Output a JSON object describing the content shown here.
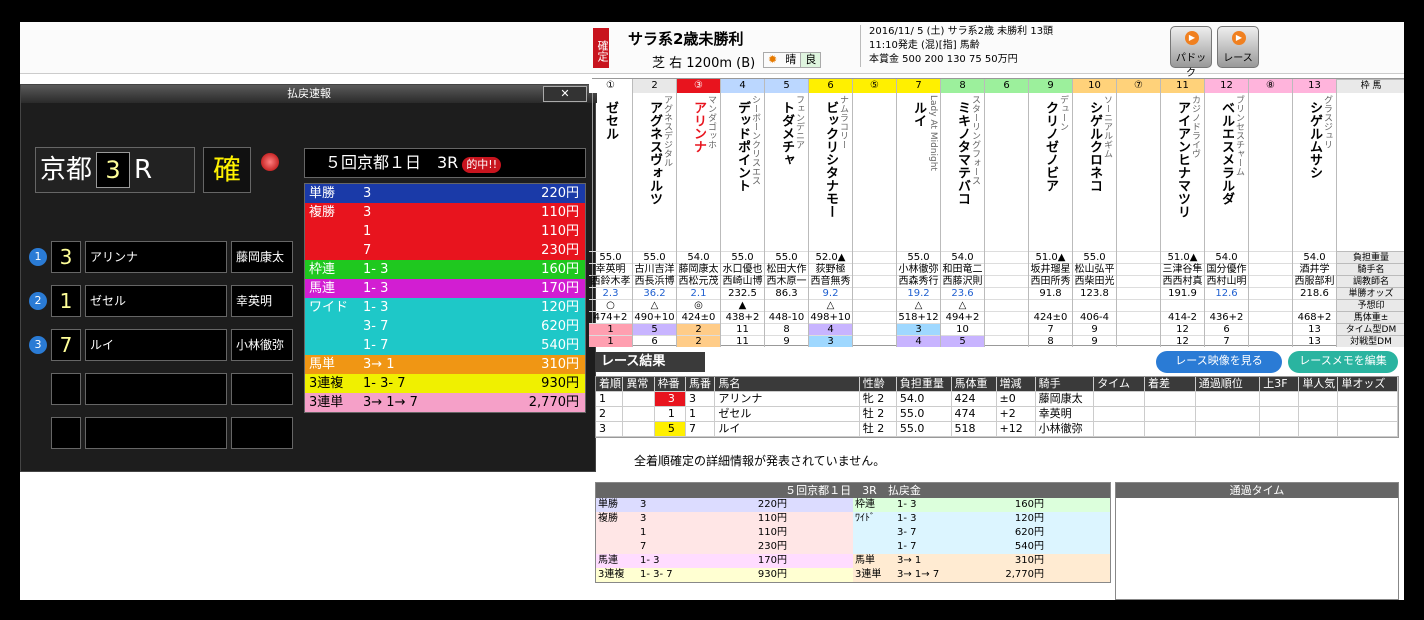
{
  "header": {
    "kakutei": "確定",
    "race_name": "サラ系2歳未勝利",
    "course": "芝 右 1200m (B)",
    "weather": "晴",
    "baba": "良",
    "info_line1": "2016/11/ 5 (土) サラ系2歳 未勝利 13頭",
    "info_line2": "11:10発走 (混)[指] 馬齢",
    "info_line3": "本賞金 500 200 130 75 50万円",
    "paddock_label": "パドック",
    "race_label": "レース"
  },
  "popup": {
    "title": "払戻速報",
    "close": "✕",
    "venue": "京都",
    "race_no": "3",
    "race_suffix": "R",
    "kaku": "確",
    "pay_header": "５回京都１日　3R",
    "hit": "的中!!",
    "ranks": [
      {
        "mark": "1",
        "horse_no": "3",
        "name": "アリンナ",
        "jockey": "藤岡康太"
      },
      {
        "mark": "2",
        "horse_no": "1",
        "name": "ゼセル",
        "jockey": "幸英明"
      },
      {
        "mark": "3",
        "horse_no": "7",
        "name": "ルイ",
        "jockey": "小林徹弥"
      }
    ],
    "payouts": [
      {
        "type": "単勝",
        "combo": "3",
        "value": "220円",
        "bg": "#1a3aa8"
      },
      {
        "type": "複勝",
        "combo": "3",
        "value": "110円",
        "bg": "#e8141e"
      },
      {
        "type": "",
        "combo": "1",
        "value": "110円",
        "bg": "#e8141e"
      },
      {
        "type": "",
        "combo": "7",
        "value": "230円",
        "bg": "#e8141e"
      },
      {
        "type": "枠連",
        "combo": "1- 3",
        "value": "160円",
        "bg": "#1fc81f"
      },
      {
        "type": "馬連",
        "combo": "1- 3",
        "value": "170円",
        "bg": "#d21ed2"
      },
      {
        "type": "ワイド",
        "combo": "1- 3",
        "value": "120円",
        "bg": "#1ec8c8"
      },
      {
        "type": "",
        "combo": "3- 7",
        "value": "620円",
        "bg": "#1ec8c8"
      },
      {
        "type": "",
        "combo": "1- 7",
        "value": "540円",
        "bg": "#1ec8c8"
      },
      {
        "type": "馬単",
        "combo": "3→ 1",
        "value": "310円",
        "bg": "#f09614"
      },
      {
        "type": "3連複",
        "combo": "1- 3- 7",
        "value": "930円",
        "bg": "#f0f000"
      },
      {
        "type": "3連単",
        "combo": "3→ 1→ 7",
        "value": "2,770円",
        "bg": "#f5a0c8"
      }
    ]
  },
  "entries": {
    "row_labels": [
      "枠 馬",
      "負担重量",
      "騎手名",
      "調教師名",
      "単勝オッズ",
      "予想印",
      "馬体重±",
      "タイム型DM",
      "対戦型DM"
    ],
    "horses": [
      {
        "waku": "13",
        "color": "#ffb4dc",
        "name": "シゲルムサシ",
        "sub": "グラスジュリ",
        "weight": "54.0",
        "jockey": "酒井学",
        "trainer": "西服部利",
        "odds": "218.6",
        "mark": "",
        "bw": "468+2",
        "dm1": "13",
        "dm2": "13"
      },
      {
        "waku": "⑧",
        "color": "#ffb4dc",
        "name": "",
        "sub": "",
        "weight": "",
        "jockey": "",
        "trainer": "",
        "odds": "",
        "mark": "",
        "bw": "",
        "dm1": "",
        "dm2": ""
      },
      {
        "waku": "12",
        "color": "#ffb4dc",
        "name": "ベルエスメラルダ",
        "sub": "ブリンセスチャーム",
        "weight": "54.0",
        "jockey": "国分優作",
        "trainer": "西村山明",
        "odds": "12.6",
        "mark": "",
        "bw": "436+2",
        "dm1": "6",
        "dm2": "7"
      },
      {
        "waku": "11",
        "color": "#ffd27a",
        "name": "アイアンヒナマツリ",
        "sub": "カジノドライヴ",
        "weight": "51.0▲",
        "jockey": "三津谷隼",
        "trainer": "西西村真",
        "odds": "191.9",
        "mark": "",
        "bw": "414-2",
        "dm1": "12",
        "dm2": "12"
      },
      {
        "waku": "⑦",
        "color": "#ffd27a",
        "name": "",
        "sub": "",
        "weight": "",
        "jockey": "",
        "trainer": "",
        "odds": "",
        "mark": "",
        "bw": "",
        "dm1": "",
        "dm2": ""
      },
      {
        "waku": "10",
        "color": "#ffd27a",
        "name": "シゲルクロネコ",
        "sub": "ソーニアルギム",
        "weight": "55.0",
        "jockey": "松山弘平",
        "trainer": "西柴田光",
        "odds": "123.8",
        "mark": "",
        "bw": "406-4",
        "dm1": "9",
        "dm2": "9"
      },
      {
        "waku": "9",
        "color": "#9cf09c",
        "name": "クリノゼノビア",
        "sub": "デューン",
        "weight": "51.0▲",
        "jockey": "坂井瑠星",
        "trainer": "西田所秀",
        "odds": "91.8",
        "mark": "",
        "bw": "424±0",
        "dm1": "7",
        "dm2": "8"
      },
      {
        "waku": "6",
        "color": "#9cf09c",
        "name": "",
        "sub": "",
        "weight": "",
        "jockey": "",
        "trainer": "",
        "odds": "",
        "mark": "",
        "bw": "",
        "dm1": "",
        "dm2": ""
      },
      {
        "waku": "8",
        "color": "#9cf09c",
        "name": "ミキノタマテバコ",
        "sub": "スターリングフォース",
        "weight": "54.0",
        "jockey": "和田竜二",
        "trainer": "西藤沢則",
        "odds": "23.6",
        "mark": "△",
        "bw": "494+2",
        "dm1": "10",
        "dm2": "5"
      },
      {
        "waku": "7",
        "color": "#fff000",
        "name": "ルイ",
        "sub": "Lady At Midnight",
        "weight": "55.0",
        "jockey": "小林徹弥",
        "trainer": "西森秀行",
        "odds": "19.2",
        "mark": "△",
        "bw": "518+12",
        "dm1": "3",
        "dm2": "4"
      },
      {
        "waku": "⑤",
        "color": "#fff000",
        "name": "",
        "sub": "",
        "weight": "",
        "jockey": "",
        "trainer": "",
        "odds": "",
        "mark": "",
        "bw": "",
        "dm1": "",
        "dm2": ""
      },
      {
        "waku": "6",
        "color": "#fff000",
        "name": "ビックリシタナモー",
        "sub": "ナムラコリー",
        "weight": "52.0▲",
        "jockey": "荻野極",
        "trainer": "西音無秀",
        "odds": "9.2",
        "mark": "△",
        "bw": "498+10",
        "dm1": "4",
        "dm2": "3"
      },
      {
        "waku": "5",
        "color": "#bbd7ff",
        "name": "トダメチャ",
        "sub": "フェンデニア",
        "weight": "55.0",
        "jockey": "松田大作",
        "trainer": "西木原一",
        "odds": "86.3",
        "mark": "",
        "bw": "448-10",
        "dm1": "8",
        "dm2": "9"
      },
      {
        "waku": "4",
        "color": "#bbd7ff",
        "name": "デッドポイント",
        "sub": "シーボーンクリスエス",
        "weight": "55.0",
        "jockey": "水口優也",
        "trainer": "西崎山博",
        "odds": "232.5",
        "mark": "▲",
        "bw": "438+2",
        "dm1": "11",
        "dm2": "11"
      },
      {
        "waku": "③",
        "color": "#e8141e",
        "name": "アリンナ",
        "sub": "マンダゴッホ",
        "weight": "54.0",
        "jockey": "藤岡康太",
        "trainer": "西松元茂",
        "odds": "2.1",
        "mark": "◎",
        "bw": "424±0",
        "dm1": "2",
        "dm2": "2"
      },
      {
        "waku": "2",
        "color": "#e8e8e8",
        "name": "アグネスヴォルツ",
        "sub": "アグネスデジタル",
        "weight": "55.0",
        "jockey": "古川吉洋",
        "trainer": "西長浜博",
        "odds": "36.2",
        "mark": "△",
        "bw": "490+10",
        "dm1": "5",
        "dm2": "6"
      },
      {
        "waku": "①",
        "color": "#fff",
        "name": "ゼセル",
        "sub": "",
        "weight": "55.0",
        "jockey": "幸英明",
        "trainer": "西鈴木孝",
        "odds": "2.3",
        "mark": "○",
        "bw": "474+2",
        "dm1": "1",
        "dm2": "1"
      }
    ]
  },
  "results": {
    "title": "レース結果",
    "btn_video": "レース映像を見る",
    "btn_memo": "レースメモを編集",
    "columns": [
      "着順",
      "異常",
      "枠番",
      "馬番",
      "馬名",
      "性齢",
      "負担重量",
      "馬体重",
      "増減",
      "騎手",
      "タイム",
      "着差",
      "通過順位",
      "上3F",
      "単人気",
      "単オッズ"
    ],
    "rows": [
      [
        "1",
        "",
        "3",
        "3",
        "アリンナ",
        "牝 2",
        "54.0",
        "424",
        "±0",
        "藤岡康太",
        "",
        "",
        "",
        "",
        "",
        ""
      ],
      [
        "2",
        "",
        "1",
        "1",
        "ゼセル",
        "牡 2",
        "55.0",
        "474",
        "+2",
        "幸英明",
        "",
        "",
        "",
        "",
        "",
        ""
      ],
      [
        "3",
        "",
        "5",
        "7",
        "ルイ",
        "牡 2",
        "55.0",
        "518",
        "+12",
        "小林徹弥",
        "",
        "",
        "",
        "",
        "",
        ""
      ]
    ],
    "notice": "全着順確定の詳細情報が発表されていません。"
  },
  "bottom_payout": {
    "title": "５回京都１日　3R　払戻金",
    "passing_title": "通過タイム",
    "rows": [
      {
        "lt": "単勝",
        "lc": "3",
        "lv": "220円",
        "lbg": "#dcdcff",
        "rt": "枠連",
        "rc": "1- 3",
        "rv": "160円",
        "rbg": "#dcffdc"
      },
      {
        "lt": "複勝",
        "lc": "3",
        "lv": "110円",
        "lbg": "#ffe6e6",
        "rt": "ﾜｲﾄﾞ",
        "rc": "1- 3",
        "rv": "120円",
        "rbg": "#dcf5ff"
      },
      {
        "lt": "",
        "lc": "1",
        "lv": "110円",
        "lbg": "#ffe6e6",
        "rt": "",
        "rc": "3- 7",
        "rv": "620円",
        "rbg": "#dcf5ff"
      },
      {
        "lt": "",
        "lc": "7",
        "lv": "230円",
        "lbg": "#ffe6e6",
        "rt": "",
        "rc": "1- 7",
        "rv": "540円",
        "rbg": "#dcf5ff"
      },
      {
        "lt": "馬連",
        "lc": "1- 3",
        "lv": "170円",
        "lbg": "#ffdcff",
        "rt": "馬単",
        "rc": "3→ 1",
        "rv": "310円",
        "rbg": "#ffebd2"
      },
      {
        "lt": "3連複",
        "lc": "1- 3- 7",
        "lv": "930円",
        "lbg": "#ffffd2",
        "rt": "3連単",
        "rc": "3→ 1→ 7",
        "rv": "2,770円",
        "rbg": "#ffebd2"
      }
    ]
  }
}
